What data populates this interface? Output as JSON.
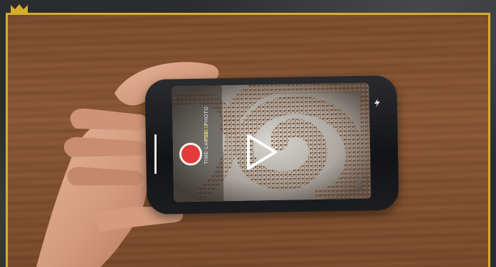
{
  "camera": {
    "modes": [
      "TIME-LAPSE",
      "VIDEO",
      "PHOTO"
    ],
    "active_mode_index": 1
  },
  "colors": {
    "frame_gold": "#d6ad2e",
    "record_red": "#e53a3a",
    "active_mode_yellow": "#f2cf29"
  },
  "icons": {
    "record": "record-icon",
    "play": "play-icon",
    "flash": "flash-icon",
    "badge": "crown-badge-icon"
  }
}
